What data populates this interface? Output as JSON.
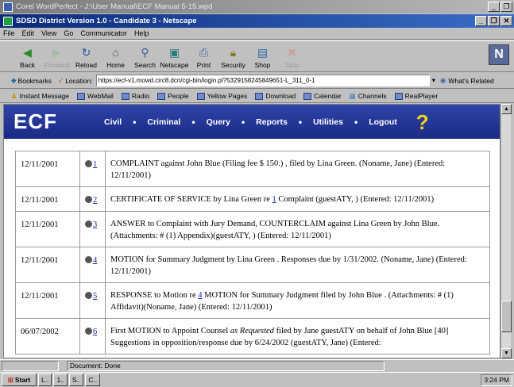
{
  "wp_title": "Corel WordPerfect - J:\\User Manual\\ECF Manual 5-15.wpd",
  "window_title": "SDSD District Version 1.0 - Candidate 3 - Netscape",
  "menu": [
    "File",
    "Edit",
    "View",
    "Go",
    "Communicator",
    "Help"
  ],
  "toolbar": [
    {
      "label": "Back",
      "icon": "back-arrow-icon",
      "enabled": true
    },
    {
      "label": "Forward",
      "icon": "forward-arrow-icon",
      "enabled": false
    },
    {
      "label": "Reload",
      "icon": "reload-icon",
      "enabled": true
    },
    {
      "label": "Home",
      "icon": "home-icon",
      "enabled": true
    },
    {
      "label": "Search",
      "icon": "search-icon",
      "enabled": true
    },
    {
      "label": "Netscape",
      "icon": "netscape-icon",
      "enabled": true
    },
    {
      "label": "Print",
      "icon": "print-icon",
      "enabled": true
    },
    {
      "label": "Security",
      "icon": "security-lock-icon",
      "enabled": true
    },
    {
      "label": "Shop",
      "icon": "shop-icon",
      "enabled": true
    },
    {
      "label": "Stop",
      "icon": "stop-icon",
      "enabled": false
    }
  ],
  "location": {
    "bookmarks": "Bookmarks",
    "label": "Location:",
    "url": "https://ecf-v1.mowd.circ8.dcn/cgi-bin/login.pl?5329158245849651-L_311_0-1",
    "related": "What's Related"
  },
  "links": [
    "Instant Message",
    "WebMail",
    "Radio",
    "People",
    "Yellow Pages",
    "Download",
    "Calendar",
    "Channels",
    "RealPlayer"
  ],
  "ecf_logo": "ECF",
  "nav": [
    "Civil",
    "Criminal",
    "Query",
    "Reports",
    "Utilities",
    "Logout"
  ],
  "help_glyph": "?",
  "entries": [
    {
      "date": "12/11/2001",
      "num": "1",
      "text": "COMPLAINT against John Blue (Filing fee $ 150.) , filed by Lina Green. (Noname, Jane) (Entered: 12/11/2001)"
    },
    {
      "date": "12/11/2001",
      "num": "2",
      "pre": "CERTIFICATE OF SERVICE by Lina Green re ",
      "link": "1",
      "post": " Complaint (guestATY, ) (Entered: 12/11/2001)"
    },
    {
      "date": "12/11/2001",
      "num": "3",
      "text": "ANSWER to Complaint with Jury Demand, COUNTERCLAIM against Lina Green by John Blue. (Attachments: # (1) Appendix)(guestATY, ) (Entered: 12/11/2001)"
    },
    {
      "date": "12/11/2001",
      "num": "4",
      "text": "MOTION for Summary Judgment by Lina Green . Responses due by 1/31/2002. (Noname, Jane) (Entered: 12/11/2001)"
    },
    {
      "date": "12/11/2001",
      "num": "5",
      "pre": "RESPONSE to Motion re ",
      "link": "4",
      "post": " MOTION for Summary Judgment filed by John Blue . (Attachments: # (1) Affidavit)(Noname, Jane) (Entered: 12/11/2001)"
    },
    {
      "date": "06/07/2002",
      "num": "6",
      "pre": "First MOTION to Appoint Counsel ",
      "italic": "as Requested",
      "post": " filed by Jane guestATY on behalf of John Blue [40] Suggestions in opposition/response due by 6/24/2002 (guestATY, Jane) (Entered:"
    }
  ],
  "status": "Document: Done",
  "taskbar": {
    "start": "Start",
    "tasks": [
      "L..",
      "1..",
      "S..",
      "C.."
    ],
    "clock": "3:24 PM"
  }
}
